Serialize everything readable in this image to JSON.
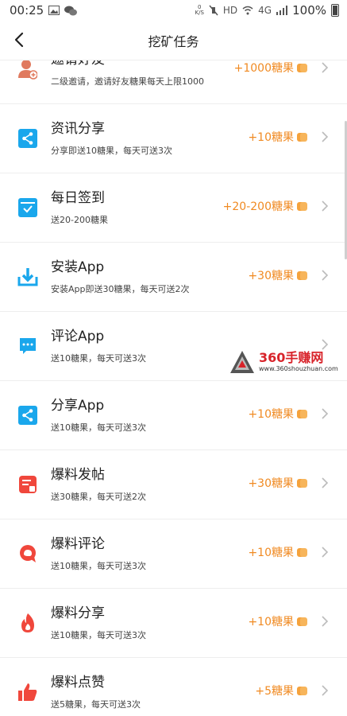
{
  "status_bar": {
    "time": "00:25",
    "net_top": "0",
    "net_bottom": "K/S",
    "hd": "HD",
    "lte": "4G",
    "battery": "100%"
  },
  "nav": {
    "title": "挖矿任务"
  },
  "tasks": [
    {
      "title": "邀请好友",
      "desc": "二级邀请，邀请好友糖果每天上限1000",
      "reward": "+1000糖果",
      "icon": "invite-friend-icon",
      "color": "#e07a5f"
    },
    {
      "title": "资讯分享",
      "desc": "分享即送10糖果，每天可送3次",
      "reward": "+10糖果",
      "icon": "share-icon",
      "color": "#1aa7ec"
    },
    {
      "title": "每日签到",
      "desc": "送20-200糖果",
      "reward": "+20-200糖果",
      "icon": "calendar-check-icon",
      "color": "#1aa7ec"
    },
    {
      "title": "安装App",
      "desc": "安装App即送30糖果，每天可送2次",
      "reward": "+30糖果",
      "icon": "download-icon",
      "color": "#1aa7ec"
    },
    {
      "title": "评论App",
      "desc": "送10糖果，每天可送3次",
      "reward": "",
      "icon": "comment-icon",
      "color": "#1aa7ec"
    },
    {
      "title": "分享App",
      "desc": "送10糖果，每天可送3次",
      "reward": "+10糖果",
      "icon": "share-icon",
      "color": "#1aa7ec"
    },
    {
      "title": "爆料发帖",
      "desc": "送30糖果，每天可送2次",
      "reward": "+30糖果",
      "icon": "post-icon",
      "color": "#f0473c"
    },
    {
      "title": "爆料评论",
      "desc": "送10糖果，每天可送3次",
      "reward": "+10糖果",
      "icon": "comment-bubble-icon",
      "color": "#f0473c"
    },
    {
      "title": "爆料分享",
      "desc": "送10糖果，每天可送3次",
      "reward": "+10糖果",
      "icon": "fire-icon",
      "color": "#f0473c"
    },
    {
      "title": "爆料点赞",
      "desc": "送5糖果，每天可送3次",
      "reward": "+5糖果",
      "icon": "thumbs-up-icon",
      "color": "#f0473c"
    }
  ],
  "watermark": {
    "main": "360手赚网",
    "url": "www.360shouzhuan.com"
  },
  "colors": {
    "accent": "#f08a22",
    "blue": "#1aa7ec",
    "red": "#f0473c"
  }
}
